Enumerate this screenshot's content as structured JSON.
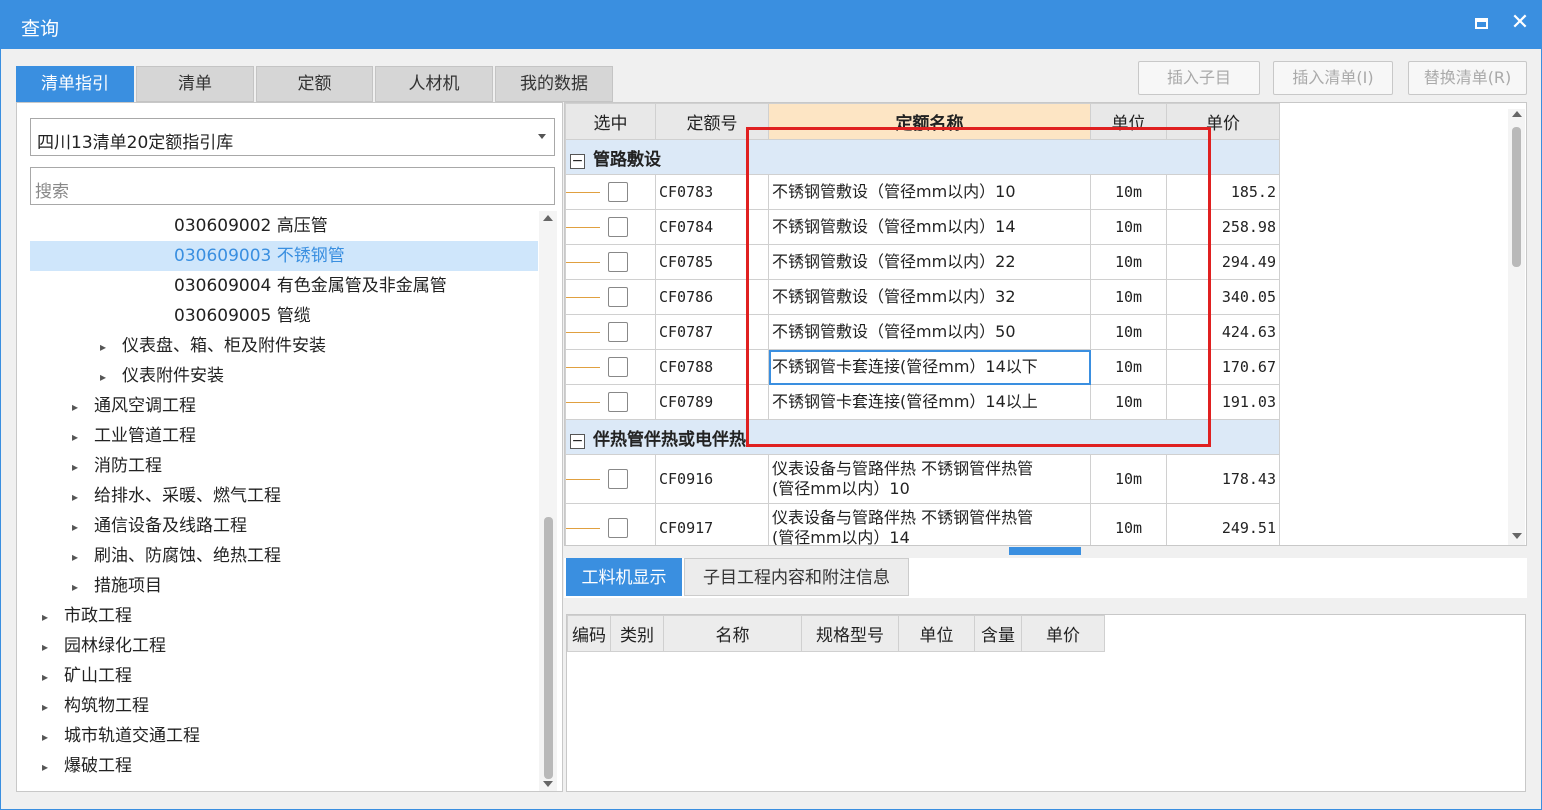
{
  "window": {
    "title": "查询"
  },
  "tabs": [
    {
      "label": "清单指引",
      "active": true
    },
    {
      "label": "清单"
    },
    {
      "label": "定额"
    },
    {
      "label": "人材机"
    },
    {
      "label": "我的数据"
    }
  ],
  "toolbar": {
    "insert_sub": "插入子目",
    "insert_list": "插入清单(I)",
    "replace_list": "替换清单(R)"
  },
  "left": {
    "library": "四川13清单20定额指引库",
    "search_placeholder": "搜索",
    "tree": [
      {
        "label": "030609002  高压管",
        "expander": ""
      },
      {
        "label": "030609003  不锈钢管",
        "expander": "",
        "selected": true
      },
      {
        "label": "030609004  有色金属管及非金属管",
        "expander": ""
      },
      {
        "label": "030609005  管缆",
        "expander": ""
      },
      {
        "label": "仪表盘、箱、柜及附件安装",
        "expander": "▸"
      },
      {
        "label": "仪表附件安装",
        "expander": "▸"
      },
      {
        "label": "通风空调工程",
        "expander": "▸"
      },
      {
        "label": "工业管道工程",
        "expander": "▸"
      },
      {
        "label": "消防工程",
        "expander": "▸"
      },
      {
        "label": "给排水、采暖、燃气工程",
        "expander": "▸"
      },
      {
        "label": "通信设备及线路工程",
        "expander": "▸"
      },
      {
        "label": "刷油、防腐蚀、绝热工程",
        "expander": "▸"
      },
      {
        "label": "措施项目",
        "expander": "▸"
      },
      {
        "label": "市政工程",
        "expander": "▸"
      },
      {
        "label": "园林绿化工程",
        "expander": "▸"
      },
      {
        "label": "矿山工程",
        "expander": "▸"
      },
      {
        "label": "构筑物工程",
        "expander": "▸"
      },
      {
        "label": "城市轨道交通工程",
        "expander": "▸"
      },
      {
        "label": "爆破工程",
        "expander": "▸"
      }
    ]
  },
  "grid": {
    "columns": {
      "select": "选中",
      "code": "定额号",
      "name": "定额名称",
      "unit": "单位",
      "price": "单价"
    },
    "groups": [
      {
        "title": "管路敷设",
        "rows": [
          {
            "code": "CF0783",
            "name": "不锈钢管敷设（管径mm以内）10",
            "unit": "10m",
            "price": "185.2"
          },
          {
            "code": "CF0784",
            "name": "不锈钢管敷设（管径mm以内）14",
            "unit": "10m",
            "price": "258.98"
          },
          {
            "code": "CF0785",
            "name": "不锈钢管敷设（管径mm以内）22",
            "unit": "10m",
            "price": "294.49"
          },
          {
            "code": "CF0786",
            "name": "不锈钢管敷设（管径mm以内）32",
            "unit": "10m",
            "price": "340.05"
          },
          {
            "code": "CF0787",
            "name": "不锈钢管敷设（管径mm以内）50",
            "unit": "10m",
            "price": "424.63"
          },
          {
            "code": "CF0788",
            "name": "不锈钢管卡套连接(管径mm）14以下",
            "unit": "10m",
            "price": "170.67"
          },
          {
            "code": "CF0789",
            "name": "不锈钢管卡套连接(管径mm）14以上",
            "unit": "10m",
            "price": "191.03"
          }
        ]
      },
      {
        "title": "伴热管伴热或电伴热",
        "rows": [
          {
            "code": "CF0916",
            "name": "仪表设备与管路伴热 不锈钢管伴热管",
            "name2": "(管径mm以内）10",
            "unit": "10m",
            "price": "178.43"
          },
          {
            "code": "CF0917",
            "name": "仪表设备与管路伴热 不锈钢管伴热管",
            "name2": "(管径mm以内）14",
            "unit": "10m",
            "price": "249.51"
          }
        ]
      }
    ]
  },
  "bottom_tabs": [
    {
      "label": "工料机显示",
      "active": true
    },
    {
      "label": "子目工程内容和附注信息"
    }
  ],
  "bottom_columns": [
    "编码",
    "类别",
    "名称",
    "规格型号",
    "单位",
    "含量",
    "单价"
  ],
  "colors": {
    "accent": "#3a8fe0",
    "highlight": "#e02020"
  }
}
